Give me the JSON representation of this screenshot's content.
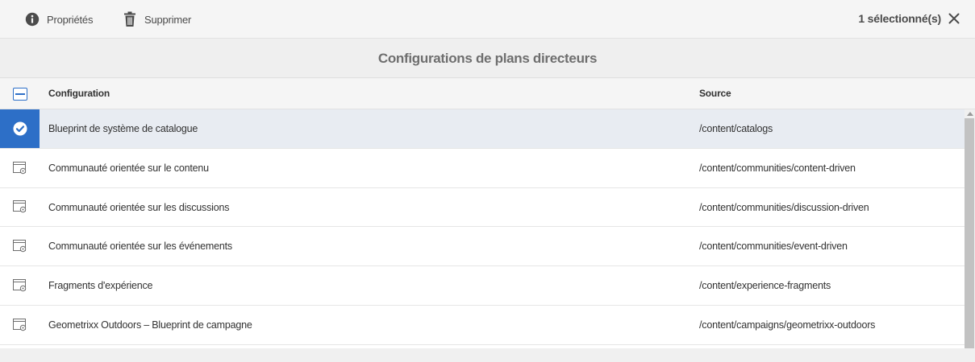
{
  "toolbar": {
    "properties_label": "Propriétés",
    "delete_label": "Supprimer",
    "selection_count": "1 sélectionné(s)"
  },
  "title": "Configurations de plans directeurs",
  "table": {
    "columns": {
      "configuration": "Configuration",
      "source": "Source"
    },
    "rows": [
      {
        "name": "Blueprint de système de catalogue",
        "source": "/content/catalogs",
        "selected": true
      },
      {
        "name": "Communauté orientée sur le contenu",
        "source": "/content/communities/content-driven",
        "selected": false
      },
      {
        "name": "Communauté orientée sur les discussions",
        "source": "/content/communities/discussion-driven",
        "selected": false
      },
      {
        "name": "Communauté orientée sur les événements",
        "source": "/content/communities/event-driven",
        "selected": false
      },
      {
        "name": "Fragments d'expérience",
        "source": "/content/experience-fragments",
        "selected": false
      },
      {
        "name": "Geometrixx Outdoors – Blueprint de campagne",
        "source": "/content/campaigns/geometrixx-outdoors",
        "selected": false
      }
    ]
  },
  "colors": {
    "accent": "#2d6fc7",
    "selected_row": "#e8ecf2"
  },
  "icons": {
    "properties": "info-icon",
    "delete": "trash-icon",
    "close": "close-icon",
    "row_thumbnail": "page-settings-icon",
    "selected_thumbnail": "checkmark-icon"
  }
}
